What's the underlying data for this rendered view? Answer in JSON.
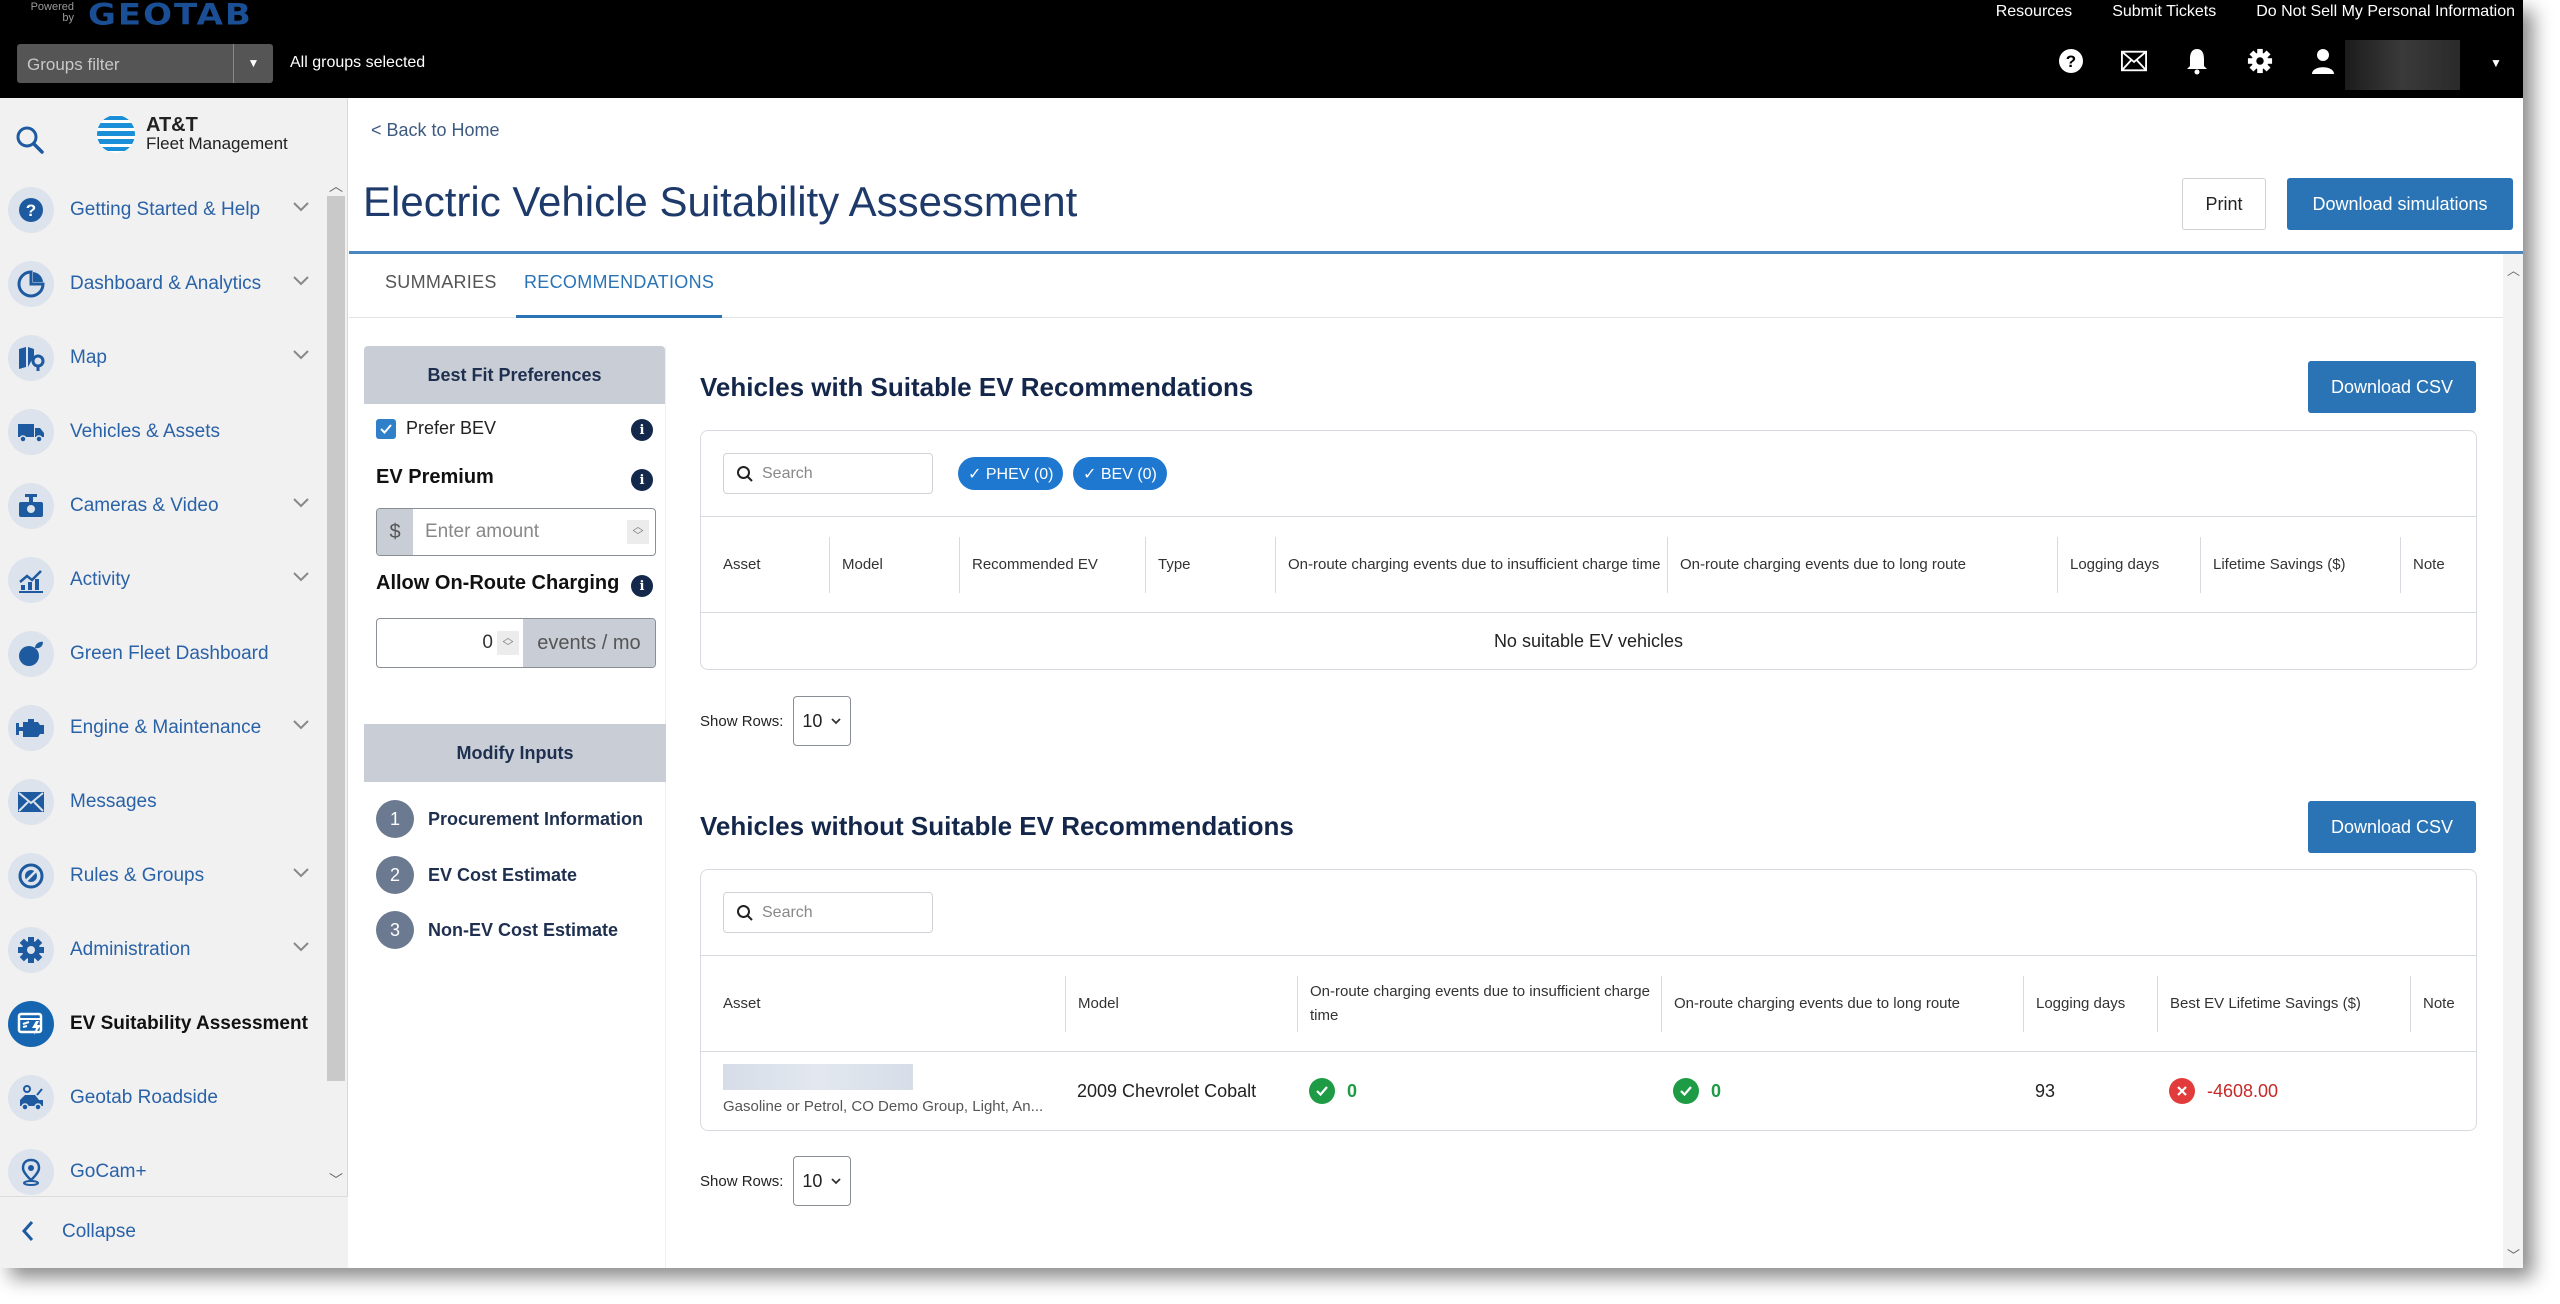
{
  "header": {
    "powered_by": "Powered by",
    "brand": "GEOTAB",
    "groups_filter_placeholder": "Groups filter",
    "groups_status": "All groups selected",
    "links": [
      "Resources",
      "Submit Tickets",
      "Do Not Sell My Personal Information"
    ],
    "icons": [
      "help-icon",
      "mail-icon",
      "bell-icon",
      "gear-icon",
      "user-icon"
    ]
  },
  "sidebar": {
    "brand_line1": "AT&T",
    "brand_line2": "Fleet Management",
    "items": [
      {
        "label": "Getting Started & Help",
        "icon": "help-icon",
        "expandable": true
      },
      {
        "label": "Dashboard & Analytics",
        "icon": "pie-chart-icon",
        "expandable": true
      },
      {
        "label": "Map",
        "icon": "map-icon",
        "expandable": true
      },
      {
        "label": "Vehicles & Assets",
        "icon": "truck-icon",
        "expandable": false
      },
      {
        "label": "Cameras & Video",
        "icon": "camera-icon",
        "expandable": true
      },
      {
        "label": "Activity",
        "icon": "activity-chart-icon",
        "expandable": true
      },
      {
        "label": "Green Fleet Dashboard",
        "icon": "leaf-icon",
        "expandable": false
      },
      {
        "label": "Engine & Maintenance",
        "icon": "engine-icon",
        "expandable": true
      },
      {
        "label": "Messages",
        "icon": "mail-icon",
        "expandable": false
      },
      {
        "label": "Rules & Groups",
        "icon": "rules-icon",
        "expandable": true
      },
      {
        "label": "Administration",
        "icon": "gear-icon",
        "expandable": true
      },
      {
        "label": "EV Suitability Assessment",
        "icon": "ev-assessment-icon",
        "expandable": false,
        "active": true
      },
      {
        "label": "Geotab Roadside",
        "icon": "tow-truck-icon",
        "expandable": false
      },
      {
        "label": "GoCam+",
        "icon": "location-pin-icon",
        "expandable": false
      }
    ],
    "collapse_label": "Collapse"
  },
  "page": {
    "back_link": "< Back to Home",
    "title": "Electric Vehicle Suitability Assessment",
    "print_label": "Print",
    "download_simulations_label": "Download simulations",
    "tabs": [
      {
        "label": "SUMMARIES",
        "active": false
      },
      {
        "label": "RECOMMENDATIONS",
        "active": true
      }
    ]
  },
  "preferences": {
    "header": "Best Fit Preferences",
    "prefer_bev_label": "Prefer BEV",
    "prefer_bev_checked": true,
    "ev_premium_label": "EV Premium",
    "currency_symbol": "$",
    "amount_placeholder": "Enter amount",
    "on_route_label": "Allow On-Route Charging",
    "on_route_value": "0",
    "on_route_unit": "events / mo"
  },
  "modify_inputs": {
    "header": "Modify Inputs",
    "steps": [
      {
        "num": "1",
        "label": "Procurement Information"
      },
      {
        "num": "2",
        "label": "EV Cost Estimate"
      },
      {
        "num": "3",
        "label": "Non-EV Cost Estimate"
      }
    ]
  },
  "suitable": {
    "title": "Vehicles with Suitable EV Recommendations",
    "download_csv_label": "Download CSV",
    "search_placeholder": "Search",
    "chips": [
      "✓ PHEV (0)",
      "✓ BEV (0)"
    ],
    "columns": [
      "Asset",
      "Model",
      "Recommended EV",
      "Type",
      "On-route charging events due to insufficient charge time",
      "On-route charging events due to long route",
      "Logging days",
      "Lifetime Savings ($)",
      "Note"
    ],
    "empty_message": "No suitable EV vehicles",
    "show_rows_label": "Show Rows:",
    "show_rows_value": "10"
  },
  "unsuitable": {
    "title": "Vehicles without Suitable EV Recommendations",
    "download_csv_label": "Download CSV",
    "search_placeholder": "Search",
    "columns": [
      "Asset",
      "Model",
      "On-route charging events due to insufficient charge time",
      "On-route charging events due to long route",
      "Logging days",
      "Best EV Lifetime Savings ($)",
      "Note"
    ],
    "rows": [
      {
        "asset_subtitle": "Gasoline or Petrol, CO Demo Group, Light, An...",
        "model": "2009 Chevrolet Cobalt",
        "insufficient_charge_events": "0",
        "long_route_events": "0",
        "logging_days": "93",
        "best_ev_lifetime_savings": "-4608.00",
        "note": ""
      }
    ],
    "show_rows_label": "Show Rows:",
    "show_rows_value": "10"
  }
}
